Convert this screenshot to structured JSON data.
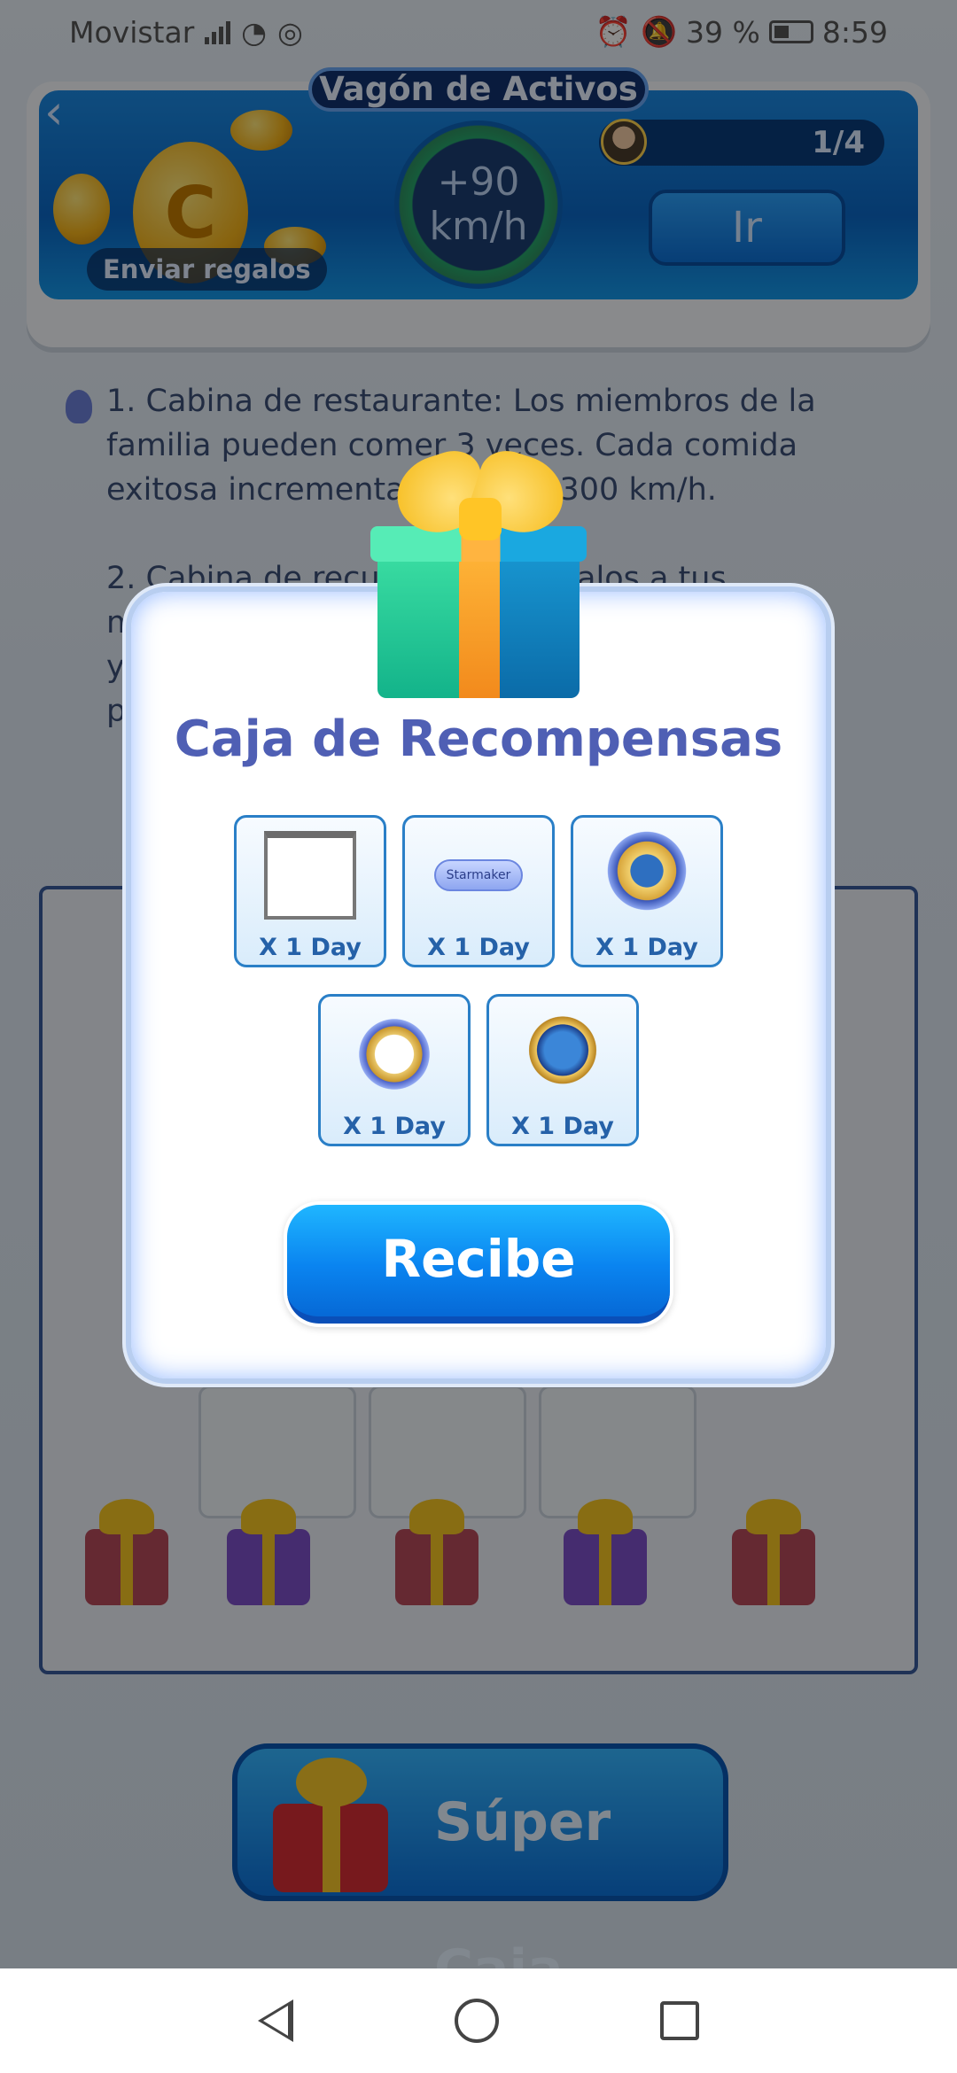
{
  "status_bar": {
    "carrier": "Movistar",
    "battery": "39 %",
    "time": "8:59"
  },
  "header": {
    "title": "Vagón de Activos",
    "send_gifts": "Enviar regalos",
    "speed_line1": "+90",
    "speed_line2": "km/h",
    "progress": "1/4",
    "go_button": "Ir"
  },
  "info": {
    "text": "1. Cabina de restaurante: Los miembros de la\nfamilia pueden comer 3 veces. Cada comida\nexitosa incrementa     idad a 300 km/h.\n\n2. Cabina de recu                  galos a tus\nm\ny\np"
  },
  "modal": {
    "title": "Caja de Recompensas",
    "rewards": [
      {
        "name": "frame",
        "qty": "X 1 Day",
        "art_text": ""
      },
      {
        "name": "name-tag",
        "qty": "X 1 Day",
        "art_text": "Starmaker"
      },
      {
        "name": "badge",
        "qty": "X 1 Day",
        "art_text": ""
      },
      {
        "name": "avatar-frame",
        "qty": "X 1 Day",
        "art_text": ""
      },
      {
        "name": "emblem",
        "qty": "X 1 Day",
        "art_text": ""
      }
    ],
    "receive_button": "Recibe"
  },
  "super_box": {
    "label": "Súper Caja"
  },
  "colors": {
    "accent_blue": "#0a84f0",
    "title_purple": "#4f5fb4"
  },
  "icons": {
    "nav": [
      "back-triangle-icon",
      "home-circle-icon",
      "recents-square-icon"
    ]
  }
}
